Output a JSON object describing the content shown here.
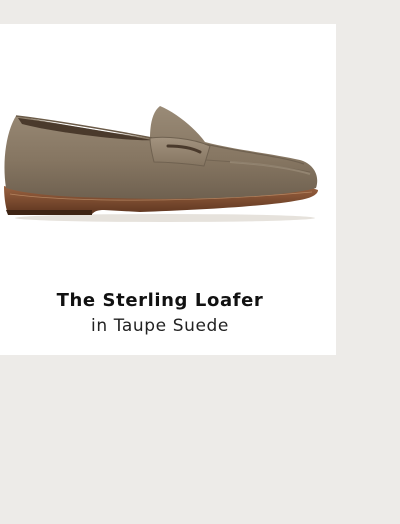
{
  "product": {
    "name": "The Sterling Loafer",
    "variant": "in Taupe Suede",
    "image_icon": "loafer-shoe-image",
    "colors": {
      "suede": "#8a7a66",
      "sole": "#7a4a2e",
      "background": "#edebe8",
      "card": "#ffffff"
    }
  }
}
